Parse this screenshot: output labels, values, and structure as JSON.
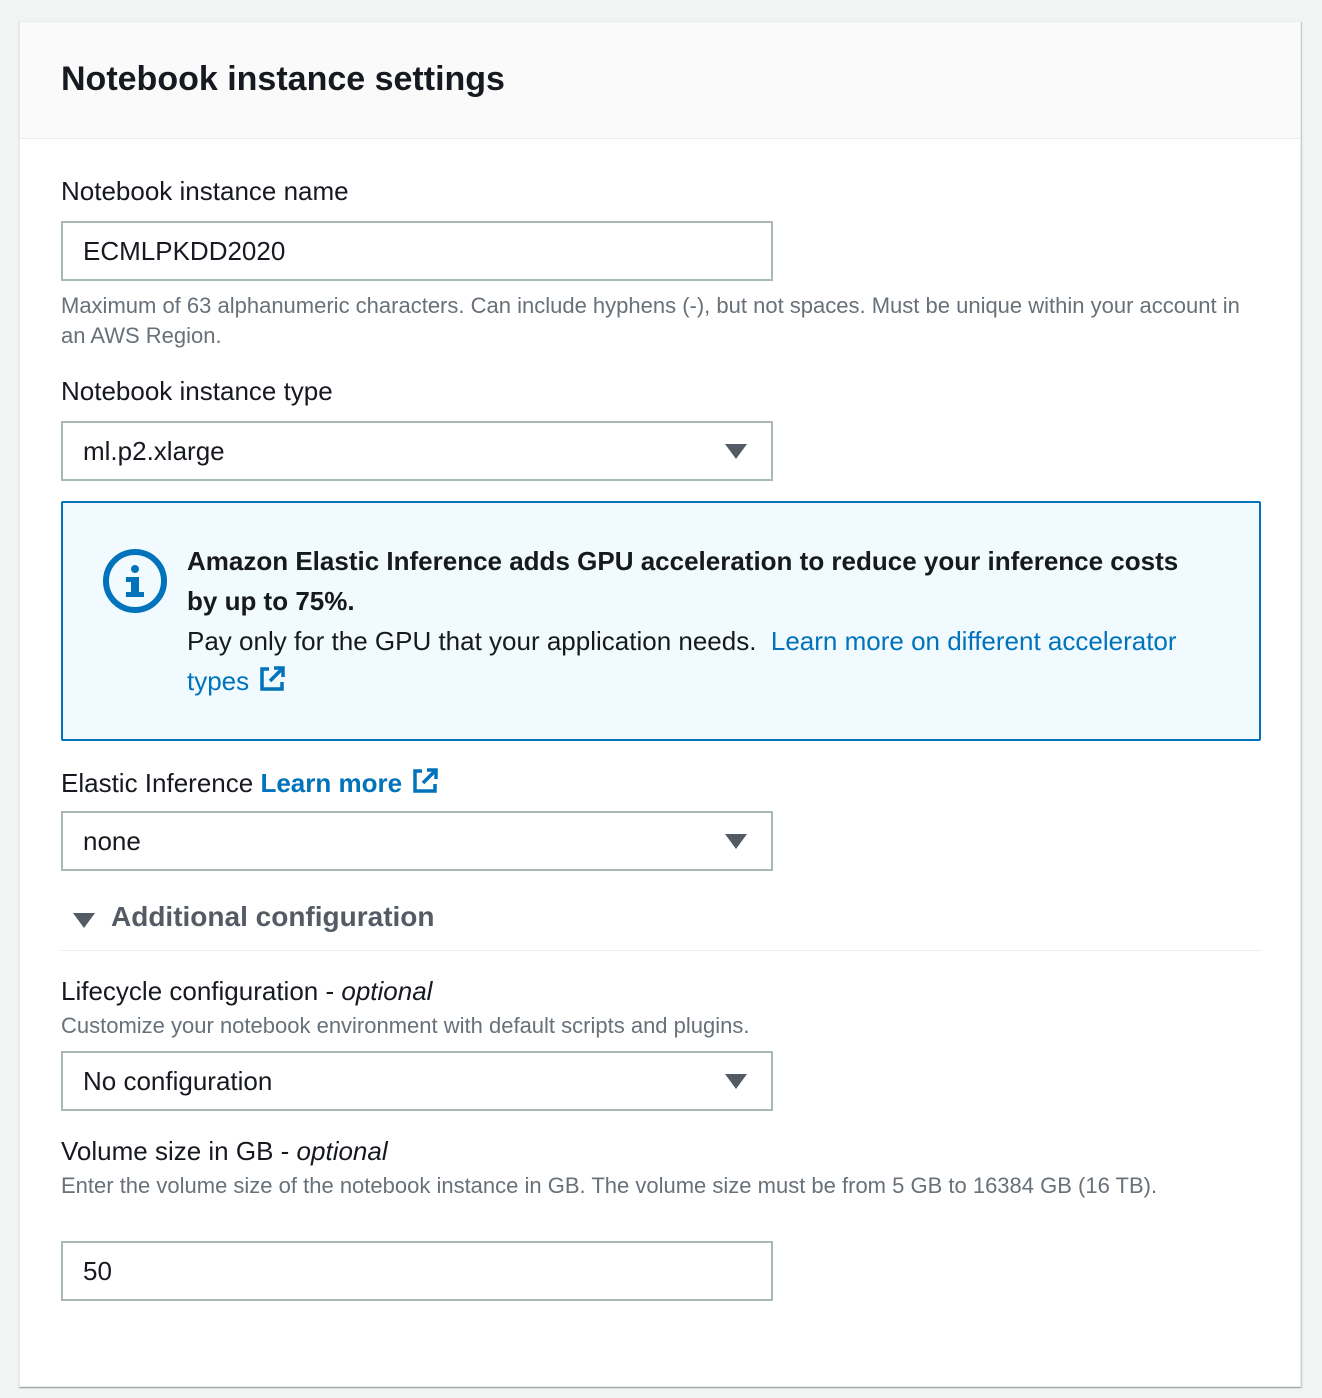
{
  "panel": {
    "title": "Notebook instance settings"
  },
  "instance_name": {
    "label": "Notebook instance name",
    "value": "ECMLPKDD2020",
    "hint": "Maximum of 63 alphanumeric characters. Can include hyphens (-), but not spaces. Must be unique within your account in an AWS Region."
  },
  "instance_type": {
    "label": "Notebook instance type",
    "value": "ml.p2.xlarge"
  },
  "info_alert": {
    "headline": "Amazon Elastic Inference adds GPU acceleration to reduce your inference costs by up to 75%.",
    "body": "Pay only for the GPU that your application needs.",
    "link_text": "Learn more on different accelerator types"
  },
  "elastic_inference": {
    "label": "Elastic Inference",
    "link_text": "Learn more",
    "value": "none"
  },
  "additional_configuration": {
    "label": "Additional configuration"
  },
  "lifecycle": {
    "label": "Lifecycle configuration - ",
    "optional": "optional",
    "hint": "Customize your notebook environment with default scripts and plugins.",
    "value": "No configuration"
  },
  "volume": {
    "label": "Volume size in GB - ",
    "optional": "optional",
    "hint": "Enter the volume size of the notebook instance in GB. The volume size must be from 5 GB to 16384 GB (16 TB).",
    "value": "50"
  },
  "colors": {
    "link": "#0073bb",
    "info_background": "#f1faff",
    "hint_text": "#687078"
  }
}
